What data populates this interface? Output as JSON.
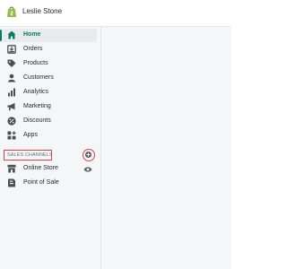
{
  "store": {
    "name": "Leslie Stone",
    "logo_icon": "shopify-bag-icon"
  },
  "nav": {
    "items": [
      {
        "label": "Home",
        "icon": "home-icon",
        "active": true
      },
      {
        "label": "Orders",
        "icon": "orders-icon"
      },
      {
        "label": "Products",
        "icon": "tag-icon"
      },
      {
        "label": "Customers",
        "icon": "person-icon"
      },
      {
        "label": "Analytics",
        "icon": "bar-chart-icon"
      },
      {
        "label": "Marketing",
        "icon": "megaphone-icon"
      },
      {
        "label": "Discounts",
        "icon": "discount-icon"
      },
      {
        "label": "Apps",
        "icon": "apps-icon"
      }
    ]
  },
  "sales_channels": {
    "header": "SALES CHANNELS",
    "add_icon": "add-circle-icon",
    "items": [
      {
        "label": "Online Store",
        "icon": "store-icon",
        "action_icon": "eye-icon"
      },
      {
        "label": "Point of Sale",
        "icon": "pos-icon"
      }
    ]
  },
  "colors": {
    "accent": "#008060",
    "highlight": "#e0424a"
  }
}
